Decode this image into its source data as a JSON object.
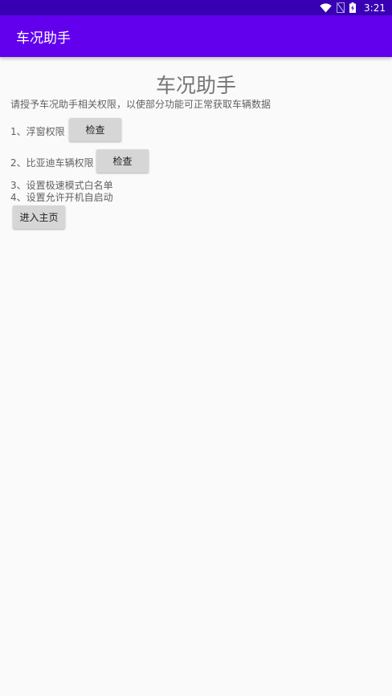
{
  "status_bar": {
    "time": "3:21",
    "icons": [
      "wifi-icon",
      "no-sim-icon",
      "battery-charging-icon"
    ]
  },
  "app_bar": {
    "title": "车况助手"
  },
  "main": {
    "title": "车况助手",
    "description": "请授予车况助手相关权限，以使部分功能可正常获取车辆数据",
    "items": [
      {
        "label": "1、浮窗权限",
        "button": "检查"
      },
      {
        "label": "2、比亚迪车辆权限",
        "button": "检查"
      },
      {
        "label": "3、设置极速模式白名单"
      },
      {
        "label": "4、设置允许开机自启动"
      }
    ],
    "enter_button": "进入主页"
  },
  "colors": {
    "status_bar": "#3700b3",
    "app_bar": "#6200ee",
    "background": "#fafafa",
    "button": "#d6d6d6"
  }
}
